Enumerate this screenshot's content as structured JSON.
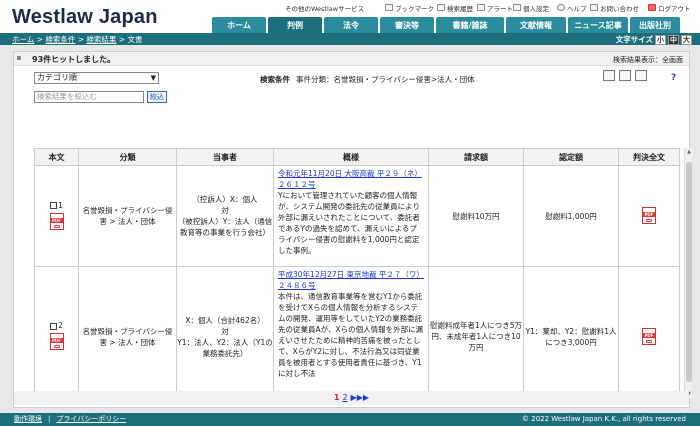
{
  "header": {
    "logo": "Westlaw Japan",
    "util": {
      "other": "その他のWestlawサービス",
      "bookmark": "ブックマーク",
      "history": "検索履歴",
      "alert": "アラート",
      "settings": "個人設定",
      "help": "ヘルプ",
      "contact": "お問い合わせ",
      "logout": "ログアウト"
    },
    "tabs": [
      "ホーム",
      "判例",
      "法令",
      "審決等",
      "書籍/雑誌",
      "文献情報",
      "ニュース記事",
      "出版社別"
    ],
    "active_tab": "判例"
  },
  "breadcrumb": {
    "home": "ホーム",
    "cond": "検索条件",
    "result": "検索結果",
    "current": "文書",
    "sep": " > "
  },
  "fontsize": {
    "label": "文字サイズ",
    "small": "小",
    "medium": "中",
    "large": "大"
  },
  "results": {
    "hits": "93件ヒットしました。",
    "display_mode": "検索結果表示：全画面",
    "sort": "カテゴリ順",
    "cond_label": "検索条件",
    "cond_value": "事件分類：名誉毀損・プライバシー侵害>法人・団体",
    "narrow_placeholder": "検索結果を絞込む",
    "narrow_button": "絞込"
  },
  "table": {
    "headers": [
      "本文",
      "分類",
      "当事者",
      "概様",
      "請求額",
      "認定額",
      "判決全文"
    ],
    "rows": [
      {
        "no": "1",
        "category": "名誉毀損・プライバシー侵害 > 法人・団体",
        "parties": "（控訴人）X：個人\n対\n（被控訴人）Y：法人（通信教育等の事業を行う会社）",
        "case_link": "令和元年11月20日 大阪高裁 平２９（ネ）２６１２号",
        "summary": "Yにおいて管理されていた顧客の個人情報が、システム開発の委託先の従業員により外部に漏えいされたことについて、委託者であるYの過失を認めて、漏えいによるプライバシー侵害の慰謝料を1,000円と認定した事例。",
        "claim": "慰謝料10万円",
        "award": "慰謝料1,000円"
      },
      {
        "no": "2",
        "category": "名誉毀損・プライバシー侵害 > 法人・団体",
        "parties": "X：個人（合計462名）\n対\nY1：法人、Y2：法人（Y1の業務委託先）",
        "case_link": "平成30年12月27日 東京地裁 平２７（ワ）２４８６号",
        "summary": "本件は、通信教育事業等を営むY1から委託を受けてXらの個人情報を分析するシステムの開発、運用等をしていたY2の業務委託先の従業員Aが、Xらの個人情報を外部に漏えいさせたために精神的苦痛を被ったとして、XらがY2に対し、不法行為又は同従業員を被用者とする使用者責任に基づき、Y1に対し不法",
        "claim": "慰謝料成年者1人につき5万円、未成年者1人につき10万円",
        "award": "Y1：棄却、Y2：慰謝料1人につき3,000円"
      }
    ]
  },
  "pager": {
    "current": "1",
    "next_page": "2",
    "next": "▶",
    "last": "▶▶"
  },
  "footer": {
    "terms": "動作環境",
    "privacy": "プライバシーポリシー",
    "copyright": "© 2022 Westlaw Japan K.K., all rights reserved"
  },
  "colors": {
    "tab": "#2a8c9c",
    "nav": "#1d6f7d",
    "link": "#1a3ad0",
    "pdf": "#dd3333"
  }
}
